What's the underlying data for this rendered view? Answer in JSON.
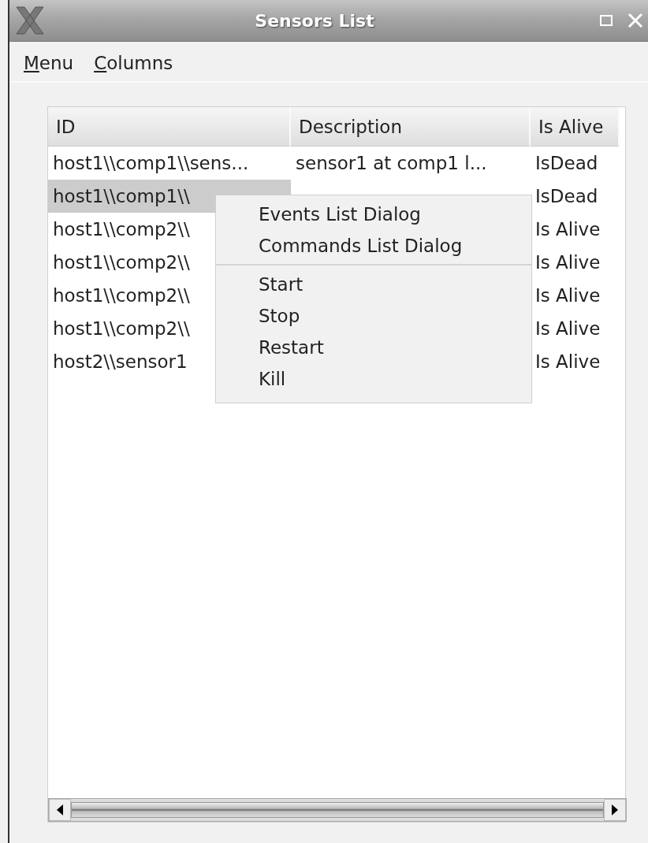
{
  "window": {
    "title": "Sensors List"
  },
  "menubar": [
    {
      "label": "Menu",
      "mnemonic": true
    },
    {
      "label": "Columns",
      "mnemonic": true
    }
  ],
  "table": {
    "columns": [
      "ID",
      "Description",
      "Is Alive"
    ],
    "rows": [
      {
        "cells": [
          "host1\\\\comp1\\\\sens...",
          "sensor1 at comp1 l...",
          "IsDead"
        ],
        "selected": false
      },
      {
        "cells": [
          "host1\\\\comp1\\\\",
          "",
          "IsDead"
        ],
        "selected": true
      },
      {
        "cells": [
          "host1\\\\comp2\\\\",
          "",
          "Is Alive"
        ],
        "selected": false
      },
      {
        "cells": [
          "host1\\\\comp2\\\\",
          "",
          "Is Alive"
        ],
        "selected": false
      },
      {
        "cells": [
          "host1\\\\comp2\\\\",
          "",
          "Is Alive"
        ],
        "selected": false
      },
      {
        "cells": [
          "host1\\\\comp2\\\\",
          "",
          "Is Alive"
        ],
        "selected": false
      },
      {
        "cells": [
          "host2\\\\sensor1",
          "",
          "Is Alive"
        ],
        "selected": false
      }
    ]
  },
  "context_menu": {
    "groups": [
      [
        "Events List Dialog",
        "Commands List Dialog"
      ],
      [
        "Start",
        "Stop",
        "Restart",
        "Kill"
      ]
    ]
  }
}
